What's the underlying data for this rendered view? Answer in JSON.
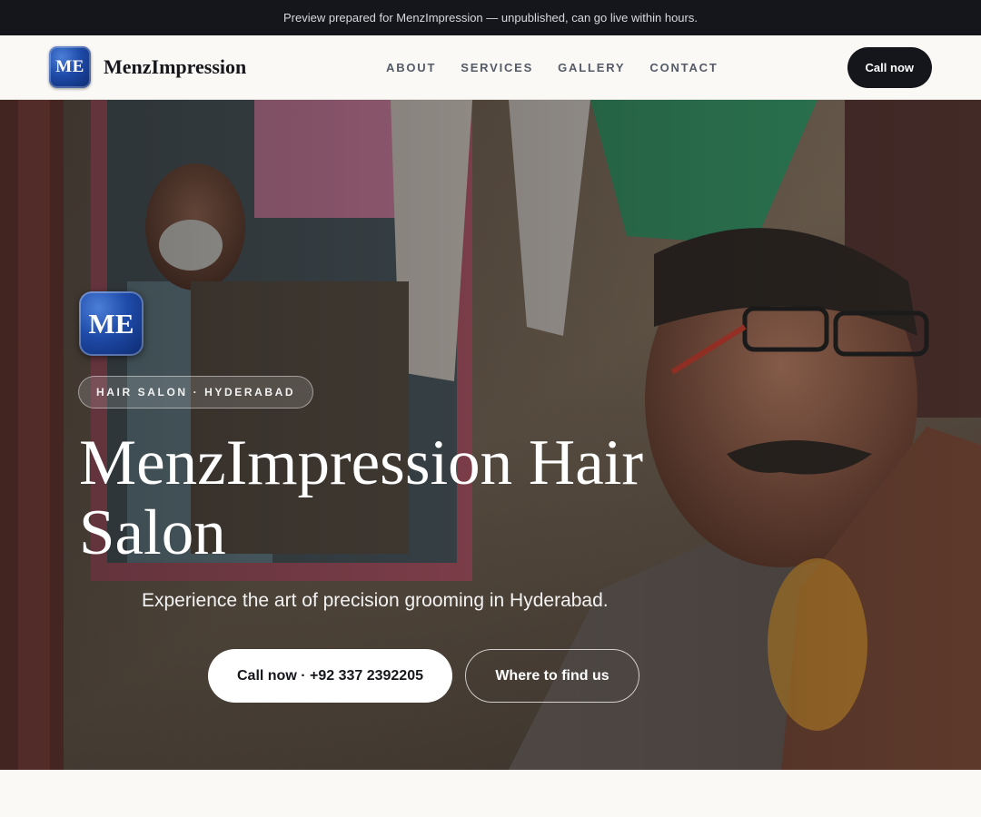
{
  "topbar": {
    "notice": "Preview prepared for MenzImpression — unpublished, can go live within hours."
  },
  "header": {
    "logo_text": "ME",
    "brand_name": "MenzImpression",
    "nav": [
      "ABOUT",
      "SERVICES",
      "GALLERY",
      "CONTACT"
    ],
    "cta_label": "Call now"
  },
  "hero": {
    "logo_text": "ME",
    "pill": "HAIR SALON · HYDERABAD",
    "title": "MenzImpression Hair Salon",
    "subtitle": "Experience the art of precision grooming in Hyderabad.",
    "primary_cta": "Call now · +92 337 2392205",
    "secondary_cta": "Where to find us"
  }
}
